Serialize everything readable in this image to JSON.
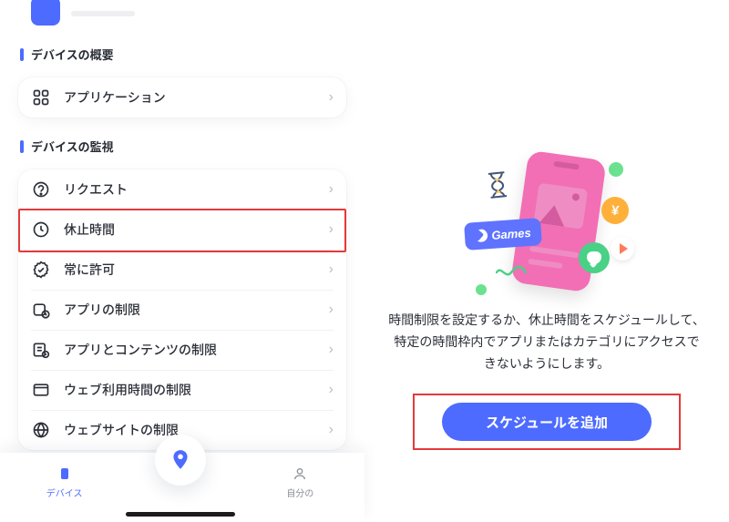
{
  "sections": {
    "overview": {
      "title": "デバイスの概要"
    },
    "monitor": {
      "title": "デバイスの監視"
    }
  },
  "menu": {
    "application": {
      "label": "アプリケーション"
    },
    "request": {
      "label": "リクエスト"
    },
    "downtime": {
      "label": "休止時間"
    },
    "always_allow": {
      "label": "常に許可"
    },
    "app_limit": {
      "label": "アプリの制限"
    },
    "content_limit": {
      "label": "アプリとコンテンツの制限"
    },
    "web_limit": {
      "label": "ウェブ利用時間の制限"
    },
    "site_limit": {
      "label": "ウェブサイトの制限"
    }
  },
  "bottom_nav": {
    "devices": "デバイス",
    "mine": "自分の"
  },
  "right": {
    "chip_text": "Games",
    "yen": "¥",
    "description": "時間制限を設定するか、休止時間をスケジュールして、特定の時間枠内でアプリまたはカテゴリにアクセスできないようにします。",
    "cta": "スケジュールを追加"
  }
}
